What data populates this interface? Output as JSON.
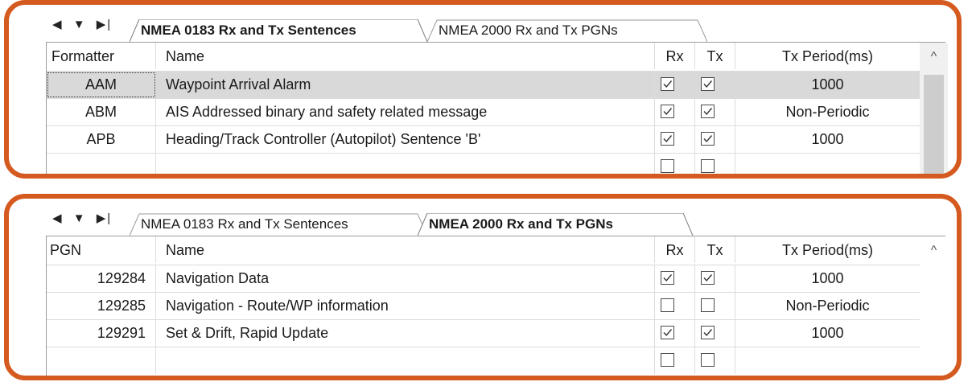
{
  "panel1": {
    "nav": {
      "prev": "◀",
      "down": "▼",
      "last": "▶|"
    },
    "tabs": [
      {
        "label": "NMEA 0183 Rx and Tx Sentences",
        "active": true
      },
      {
        "label": "NMEA 2000 Rx and Tx PGNs",
        "active": false
      }
    ],
    "columns": {
      "key": "Formatter",
      "name": "Name",
      "rx": "Rx",
      "tx": "Tx",
      "period": "Tx Period(ms)"
    },
    "rows": [
      {
        "key": "AAM",
        "name": "Waypoint Arrival Alarm",
        "rx": true,
        "tx": true,
        "period": "1000",
        "selected": true
      },
      {
        "key": "ABM",
        "name": "AIS Addressed binary and safety related message",
        "rx": true,
        "tx": true,
        "period": "Non-Periodic"
      },
      {
        "key": "APB",
        "name": "Heading/Track Controller (Autopilot) Sentence 'B'",
        "rx": true,
        "tx": true,
        "period": "1000"
      }
    ],
    "scroll_up_glyph": "^"
  },
  "panel2": {
    "nav": {
      "prev": "◀",
      "down": "▼",
      "last": "▶|"
    },
    "tabs": [
      {
        "label": "NMEA 0183 Rx and Tx Sentences",
        "active": false
      },
      {
        "label": "NMEA 2000 Rx and Tx PGNs",
        "active": true
      }
    ],
    "columns": {
      "key": "PGN",
      "name": "Name",
      "rx": "Rx",
      "tx": "Tx",
      "period": "Tx Period(ms)"
    },
    "rows": [
      {
        "key": "129284",
        "name": "Navigation Data",
        "rx": true,
        "tx": true,
        "period": "1000"
      },
      {
        "key": "129285",
        "name": "Navigation - Route/WP information",
        "rx": false,
        "tx": false,
        "period": "Non-Periodic"
      },
      {
        "key": "129291",
        "name": "Set & Drift, Rapid Update",
        "rx": true,
        "tx": true,
        "period": "1000"
      }
    ],
    "scroll_up_glyph": "^"
  },
  "colors": {
    "frame": "#d45a1f",
    "selected_row": "#d9d9d9",
    "scrollbar": "#f0f0f0"
  }
}
